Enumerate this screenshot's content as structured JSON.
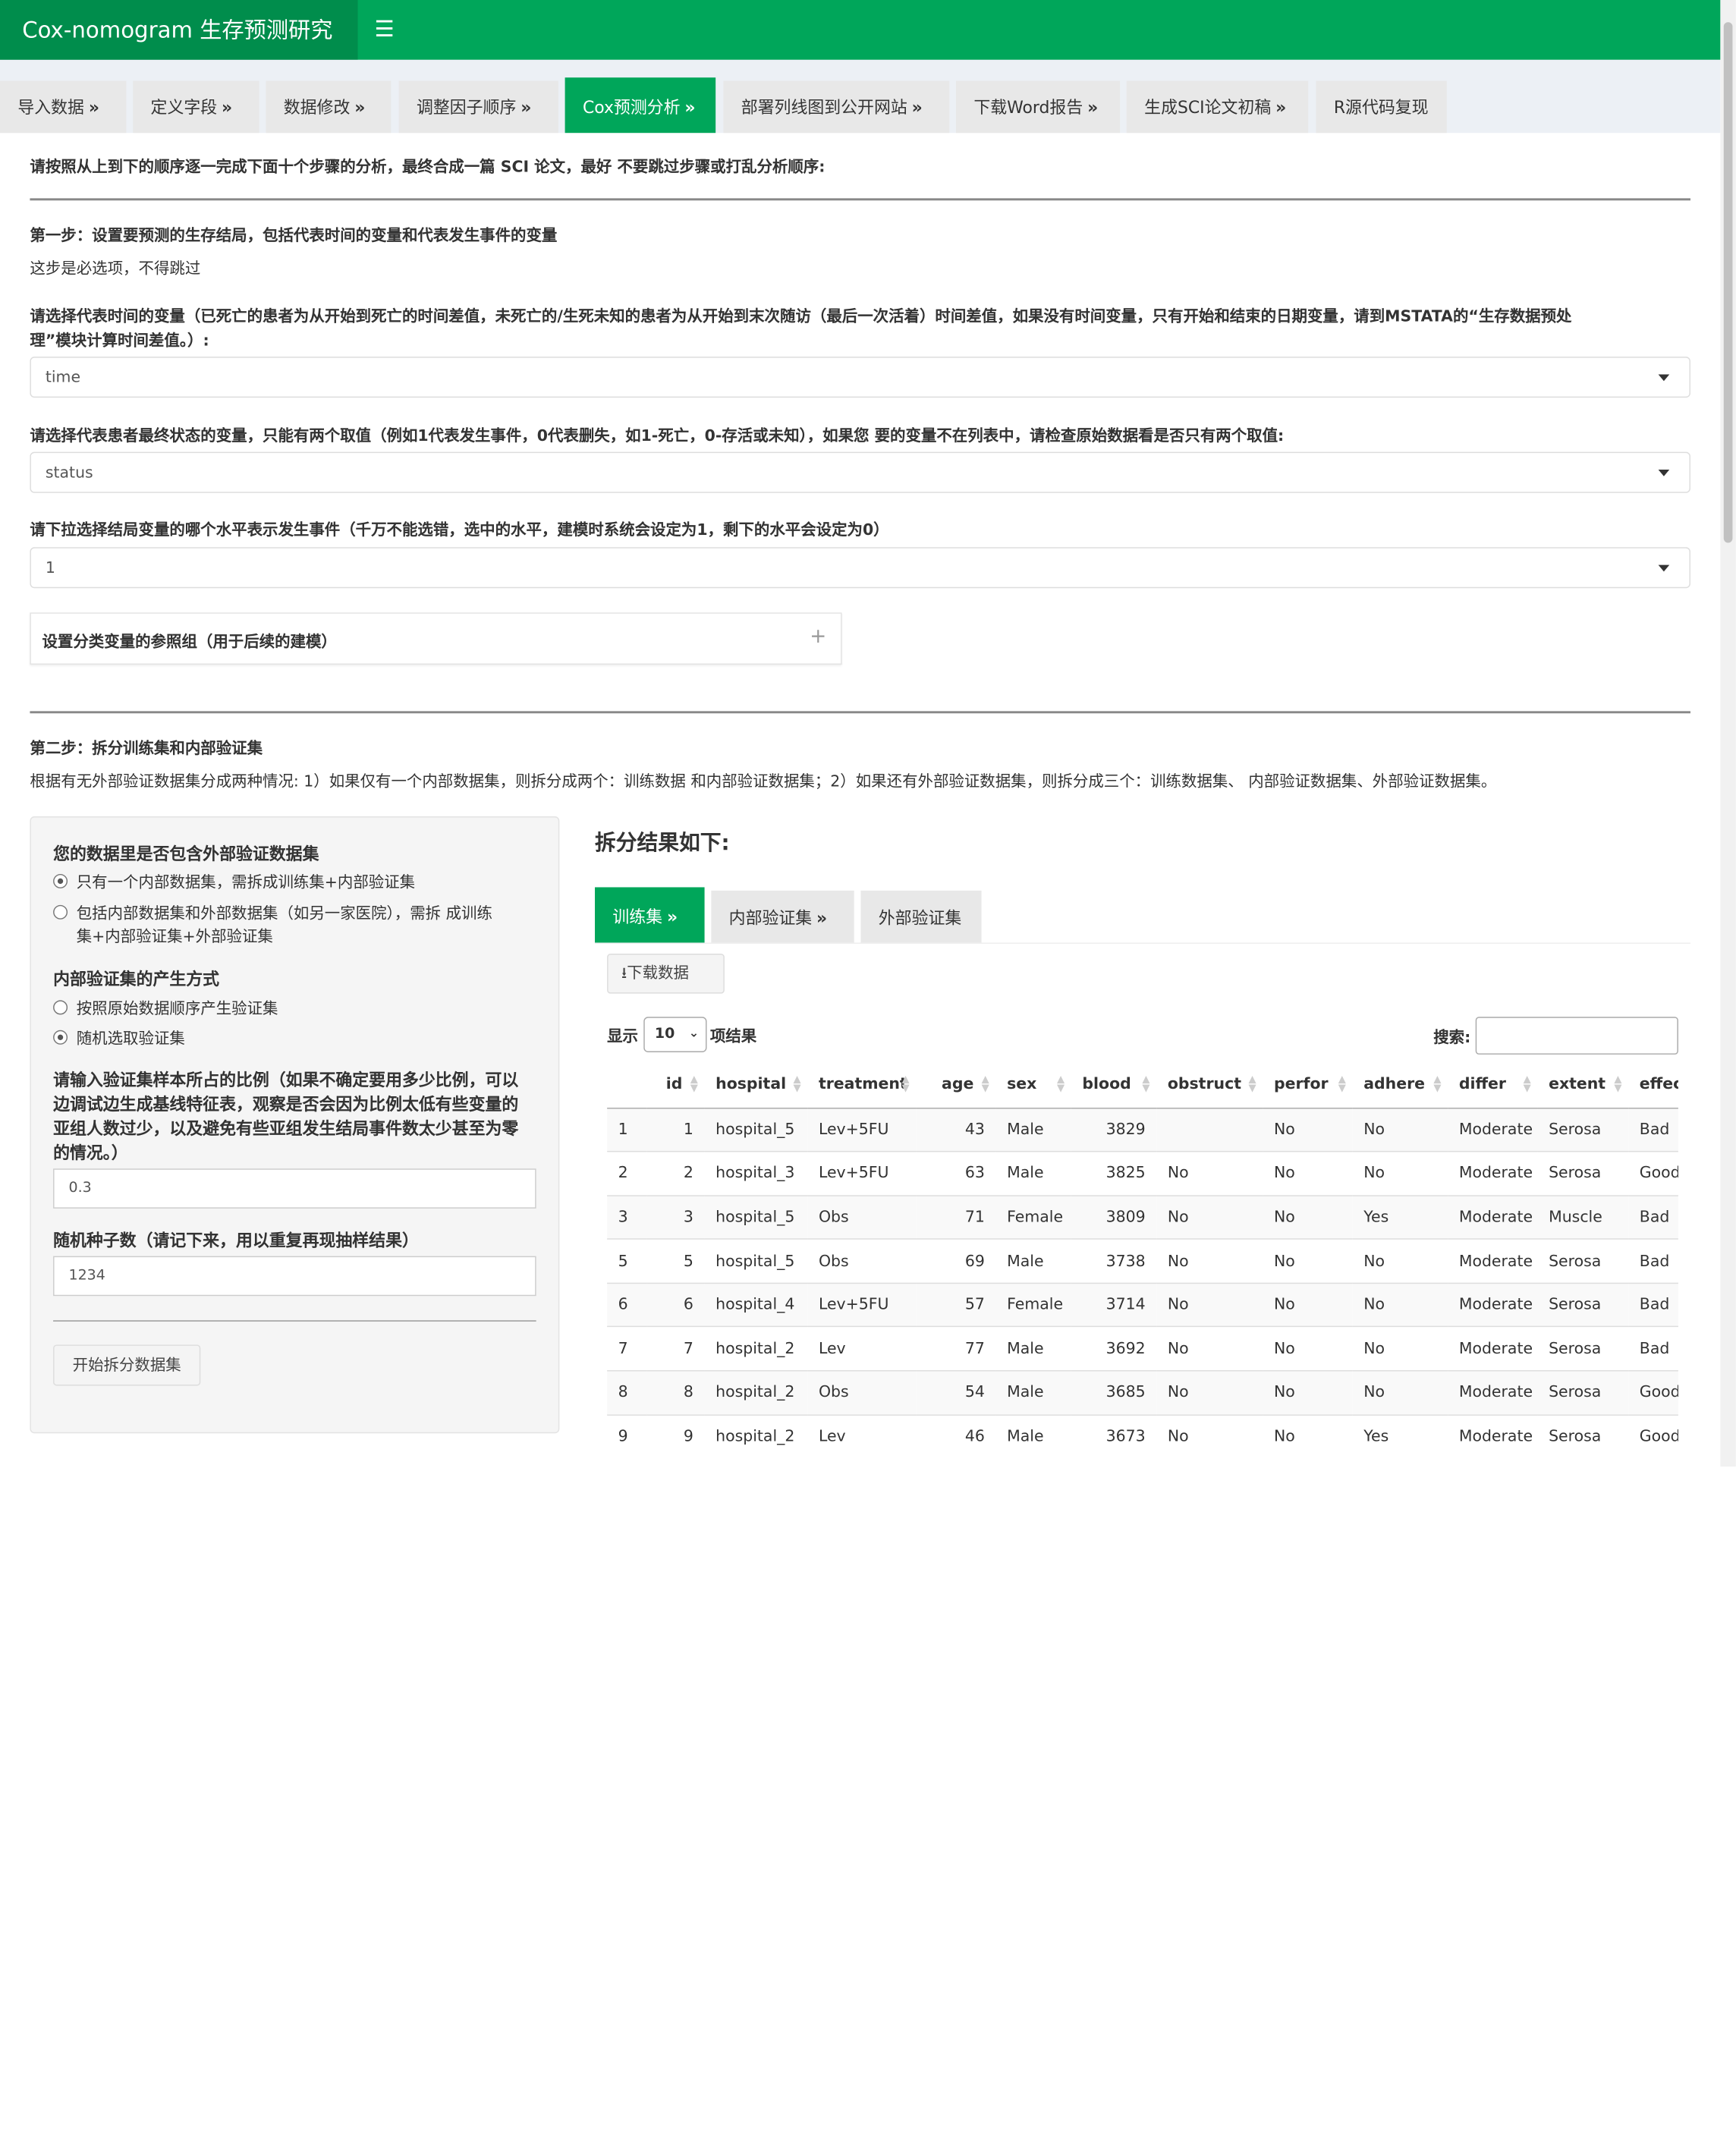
{
  "app": {
    "title": "Cox-nomogram 生存预测研究",
    "menu_icon": "hamburger-icon"
  },
  "tabs": [
    {
      "label": "导入数据"
    },
    {
      "label": "定义字段"
    },
    {
      "label": "数据修改"
    },
    {
      "label": "调整因子顺序"
    },
    {
      "label": "Cox预测分析",
      "active": true
    },
    {
      "label": "部署列线图到公开网站"
    },
    {
      "label": "下载Word报告"
    },
    {
      "label": "生成SCI论文初稿"
    },
    {
      "label": "R源代码复现"
    }
  ],
  "chevron": "»",
  "intro": "请按照从上到下的顺序逐一完成下面十个步骤的分析，最终合成一篇 SCI 论文，最好 不要跳过步骤或打乱分析顺序:",
  "step1": {
    "title": "第一步：设置要预测的生存结局，包括代表时间的变量和代表发生事件的变量",
    "note": "这步是必选项，不得跳过",
    "time_label_1": "请选择代表时间的变量（已死亡的患者为从开始到死亡的时间差值，未死亡的/生死未知的患者为从开始到末次随访（最后一次活着）时间差值，如果没有时间变量，只有开始和结束的日期变量，请到MSTATA的“生存数据预处",
    "time_label_2": "理”模块计算时间差值。）:",
    "time_value": "time",
    "status_label": "请选择代表患者最终状态的变量，只能有两个取值（例如1代表发生事件，0代表删失，如1-死亡，0-存活或未知），如果您 要的变量不在列表中，请检查原始数据看是否只有两个取值:",
    "status_value": "status",
    "level_label": "请下拉选择结局变量的哪个水平表示发生事件（千万不能选错，选中的水平，建模时系统会设定为1，剩下的水平会设定为0）",
    "level_value": "1",
    "ref_panel_title": "设置分类变量的参照组（用于后续的建模）",
    "ref_panel_icon": "+"
  },
  "step2": {
    "title": "第二步：拆分训练集和内部验证集",
    "desc": "根据有无外部验证数据集分成两种情况: 1）如果仅有一个内部数据集，则拆分成两个：训练数据 和内部验证数据集；2）如果还有外部验证数据集，则拆分成三个：训练数据集、 内部验证数据集、外部验证数据集。",
    "q1": "您的数据里是否包含外部验证数据集",
    "q1_opt1": "只有一个内部数据集，需拆成训练集+内部验证集",
    "q1_opt2_a": "包括内部数据集和外部数据集（如另一家医院），需拆 成训练",
    "q1_opt2_b": "集+内部验证集+外部验证集",
    "q2": "内部验证集的产生方式",
    "q2_opt1": "按照原始数据顺序产生验证集",
    "q2_opt2": "随机选取验证集",
    "ratio_label_1": "请输入验证集样本所占的比例（如果不确定要用多少比例，可以",
    "ratio_label_2": "边调试边生成基线特征表，观察是否会因为比例太低有些变量的",
    "ratio_label_3": "亚组人数过少，以及避免有些亚组发生结局事件数太少甚至为零",
    "ratio_label_4": "的情况。）",
    "ratio_value": "0.3",
    "seed_label": "随机种子数（请记下来，用以重复再现抽样结果）",
    "seed_value": "1234",
    "split_button": "开始拆分数据集",
    "result_title": "拆分结果如下:",
    "subtabs": [
      "训练集",
      "内部验证集",
      "外部验证集"
    ],
    "download_button": "下载数据",
    "show_label": "显示",
    "page_length": "10",
    "entries_label": "项结果",
    "search_label": "搜索:"
  },
  "table": {
    "columns": [
      "",
      "id",
      "hospital",
      "treatment",
      "age",
      "sex",
      "blood",
      "obstruct",
      "perfor",
      "adhere",
      "differ",
      "extent",
      "effec"
    ],
    "rows": [
      [
        "1",
        "1",
        "hospital_5",
        "Lev+5FU",
        "43",
        "Male",
        "3829",
        "",
        "No",
        "No",
        "Moderate",
        "Serosa",
        "Bad"
      ],
      [
        "2",
        "2",
        "hospital_3",
        "Lev+5FU",
        "63",
        "Male",
        "3825",
        "No",
        "No",
        "No",
        "Moderate",
        "Serosa",
        "Good"
      ],
      [
        "3",
        "3",
        "hospital_5",
        "Obs",
        "71",
        "Female",
        "3809",
        "No",
        "No",
        "Yes",
        "Moderate",
        "Muscle",
        "Bad"
      ],
      [
        "5",
        "5",
        "hospital_5",
        "Obs",
        "69",
        "Male",
        "3738",
        "No",
        "No",
        "No",
        "Moderate",
        "Serosa",
        "Bad"
      ],
      [
        "6",
        "6",
        "hospital_4",
        "Lev+5FU",
        "57",
        "Female",
        "3714",
        "No",
        "No",
        "No",
        "Moderate",
        "Serosa",
        "Bad"
      ],
      [
        "7",
        "7",
        "hospital_2",
        "Lev",
        "77",
        "Male",
        "3692",
        "No",
        "No",
        "No",
        "Moderate",
        "Serosa",
        "Bad"
      ],
      [
        "8",
        "8",
        "hospital_2",
        "Obs",
        "54",
        "Male",
        "3685",
        "No",
        "No",
        "No",
        "Moderate",
        "Serosa",
        "Good"
      ],
      [
        "9",
        "9",
        "hospital_2",
        "Lev",
        "46",
        "Male",
        "3673",
        "No",
        "No",
        "Yes",
        "Moderate",
        "Serosa",
        "Good"
      ]
    ]
  }
}
